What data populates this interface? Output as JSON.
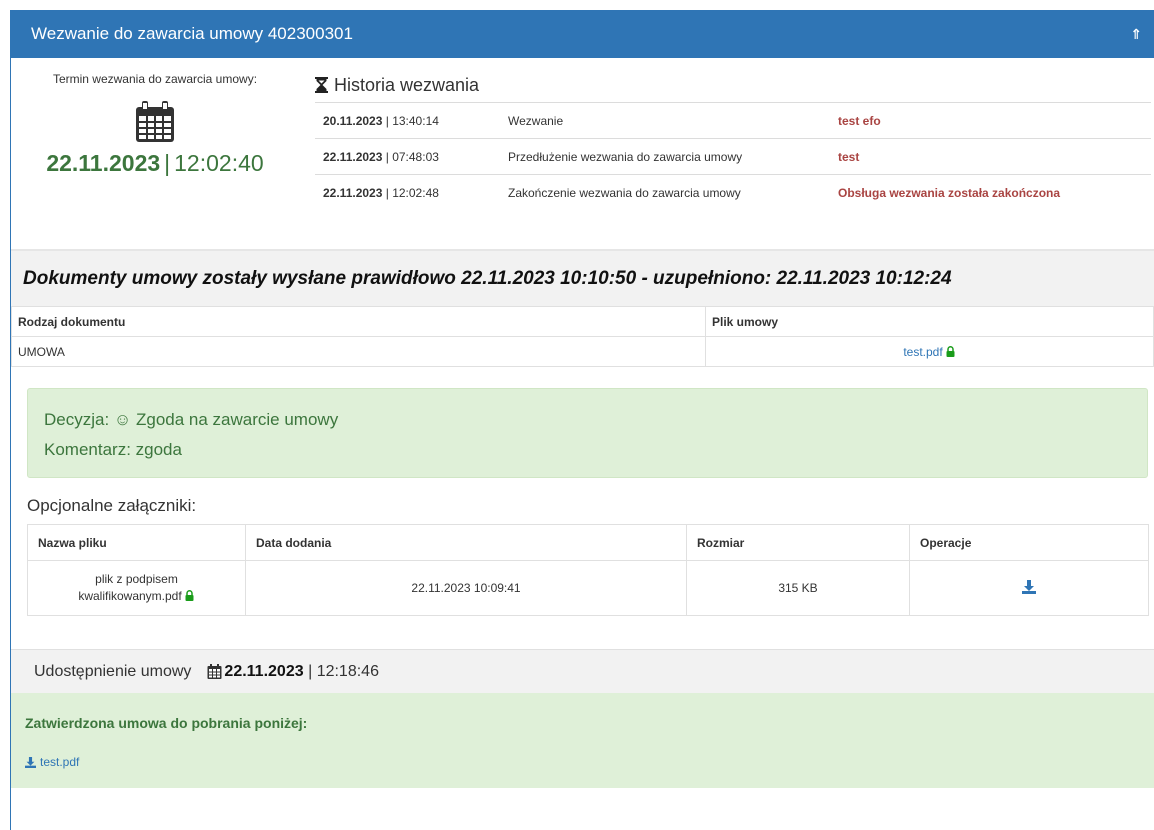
{
  "header": {
    "title": "Wezwanie do zawarcia umowy 402300301",
    "collapse_icon": "double-arrow-up-icon"
  },
  "deadline": {
    "label": "Termin wezwania do zawarcia umowy:",
    "date": "22.11.2023",
    "separator": "|",
    "time": "12:02:40"
  },
  "history": {
    "title": "Historia wezwania",
    "rows": [
      {
        "date": "20.11.2023",
        "time": "13:40:14",
        "event": "Wezwanie",
        "status": "test efo"
      },
      {
        "date": "22.11.2023",
        "time": "07:48:03",
        "event": "Przedłużenie wezwania do zawarcia umowy",
        "status": "test"
      },
      {
        "date": "22.11.2023",
        "time": "12:02:48",
        "event": "Zakończenie wezwania do zawarcia umowy",
        "status": "Obsługa wezwania została zakończona"
      }
    ]
  },
  "documents": {
    "title": "Dokumenty umowy zostały wysłane prawidłowo 22.11.2023 10:10:50 - uzupełniono: 22.11.2023 10:12:24",
    "columns": [
      "Rodzaj dokumentu",
      "Plik umowy"
    ],
    "rows": [
      {
        "type": "UMOWA",
        "file": "test.pdf"
      }
    ]
  },
  "decision": {
    "line1": "Decyzja: ☺ Zgoda na zawarcie umowy",
    "line2": "Komentarz: zgoda"
  },
  "attachments": {
    "title": "Opcjonalne załączniki:",
    "columns": [
      "Nazwa pliku",
      "Data dodania",
      "Rozmiar",
      "Operacje"
    ],
    "rows": [
      {
        "name_line1": "plik z podpisem",
        "name_line2": "kwalifikowanym.pdf",
        "date": "22.11.2023 10:09:41",
        "size": "315 KB"
      }
    ]
  },
  "share": {
    "label": "Udostępnienie umowy",
    "date": "22.11.2023",
    "separator": "|",
    "time": "12:18:46",
    "approved": "Zatwierdzona umowa do pobrania poniżej:",
    "file": "test.pdf"
  },
  "colors": {
    "header_blue": "#2f75b5",
    "success_green": "#3c763d",
    "success_bg": "#dff0d8",
    "danger_red": "#a94442"
  }
}
